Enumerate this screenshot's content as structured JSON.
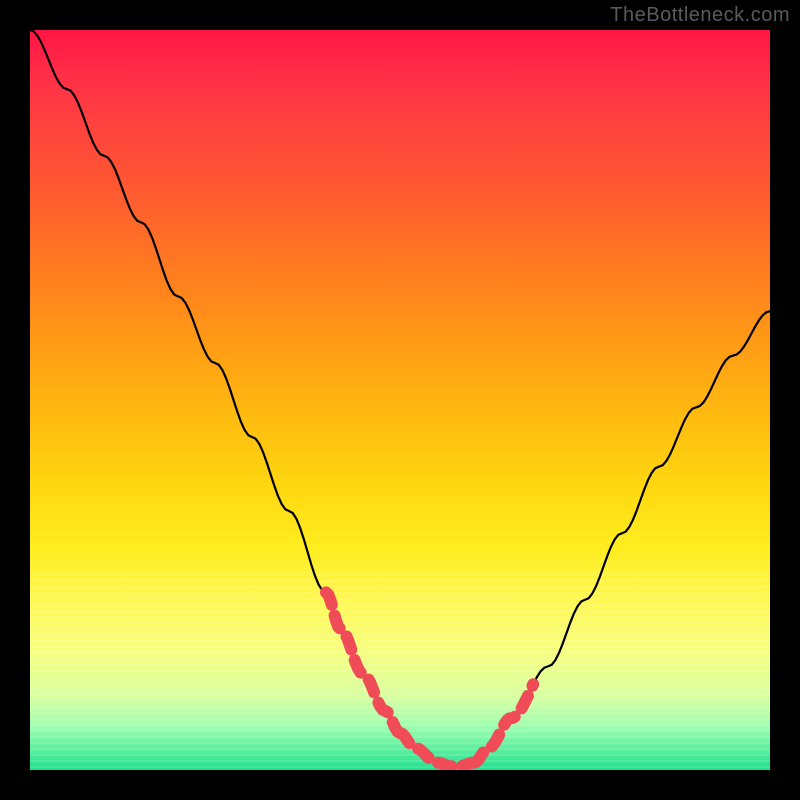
{
  "watermark": "TheBottleneck.com",
  "chart_data": {
    "type": "line",
    "title": "",
    "xlabel": "",
    "ylabel": "",
    "x_range": [
      0,
      100
    ],
    "y_range": [
      0,
      100
    ],
    "series": [
      {
        "name": "bottleneck-curve",
        "x": [
          0,
          5,
          10,
          15,
          20,
          25,
          30,
          35,
          40,
          42,
          45,
          48,
          50,
          52,
          55,
          57,
          58,
          60,
          62,
          65,
          70,
          75,
          80,
          85,
          90,
          95,
          100
        ],
        "y": [
          100,
          92,
          83,
          74,
          64,
          55,
          45,
          35,
          24,
          19,
          13,
          8,
          5,
          3,
          1,
          0.5,
          0.5,
          1,
          3,
          7,
          14,
          23,
          32,
          41,
          49,
          56,
          62
        ],
        "color": "#000000"
      }
    ],
    "highlights": [
      {
        "name": "left-dash",
        "x_start": 40,
        "x_end": 50,
        "style": "dashed",
        "color": "#ef4c57"
      },
      {
        "name": "bottom-dash",
        "x_start": 50,
        "x_end": 60,
        "style": "dashed",
        "color": "#ef4c57"
      },
      {
        "name": "right-dash",
        "x_start": 60,
        "x_end": 68,
        "style": "dashed",
        "color": "#ef4c57"
      }
    ],
    "background": {
      "type": "vertical-gradient",
      "stops": [
        {
          "pos": 0,
          "color": "#ff1744"
        },
        {
          "pos": 0.5,
          "color": "#ffd000"
        },
        {
          "pos": 0.85,
          "color": "#f0ff80"
        },
        {
          "pos": 1,
          "color": "#20e090"
        }
      ]
    }
  }
}
